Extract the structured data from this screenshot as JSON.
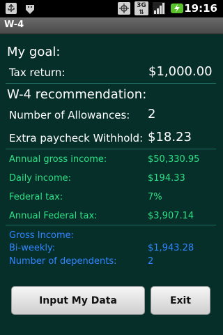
{
  "status_bar": {
    "time": "19:16",
    "icons": [
      "usb-icon",
      "android-debug-icon",
      "gps-icon",
      "3g-signal-icon",
      "signal-strength-icon",
      "battery-charging-icon"
    ],
    "threeg_label": "3G"
  },
  "title_bar": {
    "title": "W-4"
  },
  "goal": {
    "heading": "My goal:",
    "tax_return_label": "Tax return:",
    "tax_return_value": "$1,000.00"
  },
  "recommendation": {
    "heading": "W-4 recommendation:",
    "allowances_label": "Number of Allowances:",
    "allowances_value": "2",
    "extra_label": "Extra paycheck Withhold:",
    "extra_value": "$18.23"
  },
  "summary": {
    "annual_gross_label": "Annual gross income:",
    "annual_gross_value": "$50,330.95",
    "daily_label": "Daily income:",
    "daily_value": "$194.33",
    "federal_tax_label": "Federal tax:",
    "federal_tax_value": "7%",
    "annual_federal_label": "Annual Federal tax:",
    "annual_federal_value": "$3,907.14"
  },
  "inputs": {
    "gross_income_label": "Gross Income:",
    "biweekly_label": "Bi-weekly:",
    "biweekly_value": "$1,943.28",
    "dependents_label": "Number of dependents:",
    "dependents_value": "2"
  },
  "buttons": {
    "input_data_label": "Input My Data",
    "exit_label": "Exit"
  },
  "colors": {
    "background": "#062f2a",
    "accent_green": "#2ee085",
    "accent_blue": "#2f86ff",
    "divider": "#1f6d62"
  }
}
